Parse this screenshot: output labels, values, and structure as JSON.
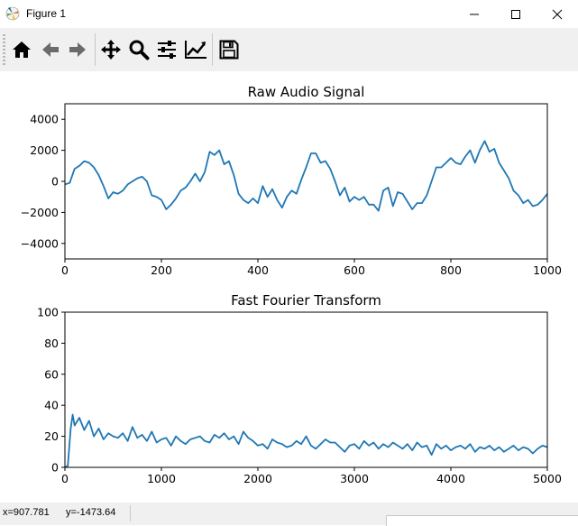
{
  "window": {
    "title": "Figure 1",
    "icons": {
      "app": "matplotlib-icon",
      "minimize": "minimize-icon",
      "maximize": "maximize-icon",
      "close": "close-icon"
    }
  },
  "toolbar": {
    "tools": [
      {
        "name": "home",
        "icon": "home-icon"
      },
      {
        "name": "back",
        "icon": "arrow-left-icon"
      },
      {
        "name": "forward",
        "icon": "arrow-right-icon"
      },
      {
        "name": "pan",
        "icon": "move-icon"
      },
      {
        "name": "zoom",
        "icon": "magnifier-icon"
      },
      {
        "name": "subplots",
        "icon": "sliders-icon"
      },
      {
        "name": "edit-axes",
        "icon": "line-chart-icon"
      },
      {
        "name": "save",
        "icon": "floppy-disk-icon"
      }
    ]
  },
  "status": {
    "x": "x=907.781",
    "y": "y=-1473.64"
  },
  "colors": {
    "series": "#1f77b4",
    "toolbar": "#f0f0f0"
  },
  "chart_data": [
    {
      "type": "line",
      "title": "Raw Audio Signal",
      "xlim": [
        0,
        1000
      ],
      "ylim": [
        -5000,
        5000
      ],
      "xticks": [
        0,
        200,
        400,
        600,
        800,
        1000
      ],
      "yticks": [
        -4000,
        -2000,
        0,
        2000,
        4000
      ],
      "ytick_labels": [
        "−4000",
        "−2000",
        "0",
        "2000",
        "4000"
      ],
      "grid": false,
      "x": [
        0,
        10,
        20,
        30,
        40,
        50,
        60,
        70,
        80,
        90,
        100,
        110,
        120,
        130,
        140,
        150,
        160,
        170,
        180,
        190,
        200,
        210,
        220,
        230,
        240,
        250,
        260,
        270,
        280,
        290,
        300,
        310,
        320,
        330,
        340,
        350,
        360,
        370,
        380,
        390,
        400,
        410,
        420,
        430,
        440,
        450,
        460,
        470,
        480,
        490,
        500,
        510,
        520,
        530,
        540,
        550,
        560,
        570,
        580,
        590,
        600,
        610,
        620,
        630,
        640,
        650,
        660,
        670,
        680,
        690,
        700,
        710,
        720,
        730,
        740,
        750,
        760,
        770,
        780,
        790,
        800,
        810,
        820,
        830,
        840,
        850,
        860,
        870,
        880,
        890,
        900,
        910,
        920,
        930,
        940,
        950,
        960,
        970,
        980,
        990,
        1000
      ],
      "y": [
        -200,
        -100,
        800,
        1000,
        1300,
        1200,
        900,
        400,
        -300,
        -1100,
        -700,
        -800,
        -600,
        -200,
        0,
        200,
        300,
        0,
        -900,
        -1000,
        -1200,
        -1800,
        -1500,
        -1100,
        -600,
        -400,
        0,
        500,
        0,
        600,
        1900,
        1700,
        2000,
        1100,
        1300,
        400,
        -800,
        -1200,
        -1400,
        -1100,
        -1400,
        -300,
        -1000,
        -500,
        -1200,
        -1700,
        -1000,
        -600,
        -800,
        100,
        900,
        1800,
        1800,
        1200,
        1300,
        800,
        0,
        -900,
        -400,
        -1300,
        -1000,
        -1200,
        -1000,
        -1500,
        -1500,
        -1900,
        -600,
        -400,
        -1600,
        -700,
        -800,
        -1300,
        -1800,
        -1400,
        -1400,
        -900,
        0,
        900,
        900,
        1200,
        1500,
        1200,
        1100,
        1600,
        2000,
        1200,
        2000,
        2600,
        1900,
        2100,
        1200,
        700,
        200,
        -600,
        -900,
        -1400,
        -1200,
        -1600,
        -1500,
        -1200,
        -800
      ]
    },
    {
      "type": "line",
      "title": "Fast Fourier Transform",
      "xlim": [
        0,
        5000
      ],
      "ylim": [
        0,
        100
      ],
      "xticks": [
        0,
        1000,
        2000,
        3000,
        4000,
        5000
      ],
      "yticks": [
        0,
        20,
        40,
        60,
        80,
        100
      ],
      "grid": false,
      "x": [
        0,
        30,
        60,
        80,
        100,
        150,
        200,
        250,
        300,
        350,
        400,
        450,
        500,
        550,
        600,
        650,
        700,
        750,
        800,
        850,
        900,
        950,
        1000,
        1050,
        1100,
        1150,
        1200,
        1250,
        1300,
        1350,
        1400,
        1450,
        1500,
        1550,
        1600,
        1650,
        1700,
        1750,
        1800,
        1850,
        1900,
        1950,
        2000,
        2050,
        2100,
        2150,
        2200,
        2250,
        2300,
        2350,
        2400,
        2450,
        2500,
        2550,
        2600,
        2650,
        2700,
        2750,
        2800,
        2850,
        2900,
        2950,
        3000,
        3050,
        3100,
        3150,
        3200,
        3250,
        3300,
        3350,
        3400,
        3450,
        3500,
        3550,
        3600,
        3650,
        3700,
        3750,
        3800,
        3850,
        3900,
        3950,
        4000,
        4050,
        4100,
        4150,
        4200,
        4250,
        4300,
        4350,
        4400,
        4450,
        4500,
        4550,
        4600,
        4650,
        4700,
        4750,
        4800,
        4850,
        4900,
        4950,
        5000
      ],
      "y": [
        0,
        1,
        25,
        34,
        27,
        32,
        24,
        30,
        20,
        25,
        18,
        22,
        20,
        19,
        22,
        17,
        26,
        19,
        21,
        17,
        23,
        16,
        18,
        19,
        14,
        20,
        17,
        15,
        18,
        19,
        20,
        17,
        16,
        21,
        19,
        22,
        18,
        20,
        15,
        23,
        19,
        17,
        14,
        15,
        12,
        18,
        16,
        15,
        13,
        14,
        17,
        15,
        20,
        14,
        12,
        15,
        18,
        16,
        16,
        13,
        10,
        14,
        15,
        12,
        17,
        14,
        16,
        12,
        15,
        13,
        16,
        14,
        12,
        15,
        11,
        16,
        13,
        14,
        8,
        15,
        12,
        14,
        11,
        13,
        14,
        12,
        15,
        10,
        13,
        12,
        14,
        11,
        13,
        10,
        12,
        14,
        11,
        13,
        12,
        9,
        12,
        14,
        13
      ]
    }
  ]
}
